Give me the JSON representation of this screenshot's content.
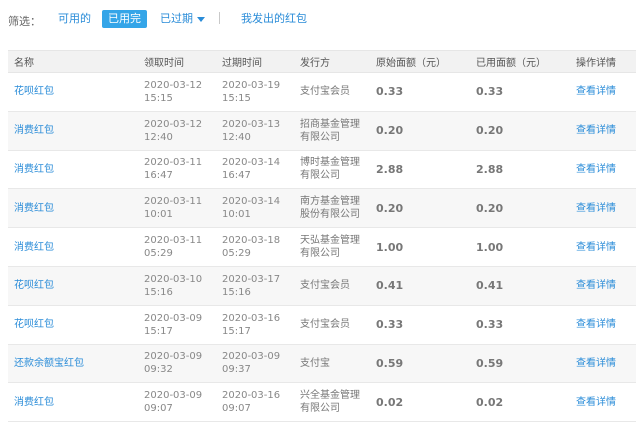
{
  "filter": {
    "label": "筛选：",
    "available": "可用的",
    "used_up": "已用完",
    "expired": "已过期",
    "sent": "我发出的红包"
  },
  "table": {
    "headers": [
      "名称",
      "领取时间",
      "过期时间",
      "发行方",
      "原始面额（元）",
      "已用面额（元）",
      "操作详情"
    ],
    "rows": [
      {
        "name": "花呗红包",
        "recv_date": "2020-03-12",
        "recv_time": "15:15",
        "exp_date": "2020-03-19",
        "exp_time": "15:15",
        "issuer_l1": "支付宝会员",
        "issuer_l2": "",
        "orig": "0.33",
        "used": "0.33",
        "op": "查看详情"
      },
      {
        "name": "消费红包",
        "recv_date": "2020-03-12",
        "recv_time": "12:40",
        "exp_date": "2020-03-13",
        "exp_time": "12:40",
        "issuer_l1": "招商基金管理",
        "issuer_l2": "有限公司",
        "orig": "0.20",
        "used": "0.20",
        "op": "查看详情"
      },
      {
        "name": "消费红包",
        "recv_date": "2020-03-11",
        "recv_time": "16:47",
        "exp_date": "2020-03-14",
        "exp_time": "16:47",
        "issuer_l1": "博时基金管理",
        "issuer_l2": "有限公司",
        "orig": "2.88",
        "used": "2.88",
        "op": "查看详情"
      },
      {
        "name": "消费红包",
        "recv_date": "2020-03-11",
        "recv_time": "10:01",
        "exp_date": "2020-03-14",
        "exp_time": "10:01",
        "issuer_l1": "南方基金管理",
        "issuer_l2": "股份有限公司",
        "orig": "0.20",
        "used": "0.20",
        "op": "查看详情"
      },
      {
        "name": "消费红包",
        "recv_date": "2020-03-11",
        "recv_time": "05:29",
        "exp_date": "2020-03-18",
        "exp_time": "05:29",
        "issuer_l1": "天弘基金管理",
        "issuer_l2": "有限公司",
        "orig": "1.00",
        "used": "1.00",
        "op": "查看详情"
      },
      {
        "name": "花呗红包",
        "recv_date": "2020-03-10",
        "recv_time": "15:16",
        "exp_date": "2020-03-17",
        "exp_time": "15:16",
        "issuer_l1": "支付宝会员",
        "issuer_l2": "",
        "orig": "0.41",
        "used": "0.41",
        "op": "查看详情"
      },
      {
        "name": "花呗红包",
        "recv_date": "2020-03-09",
        "recv_time": "15:17",
        "exp_date": "2020-03-16",
        "exp_time": "15:17",
        "issuer_l1": "支付宝会员",
        "issuer_l2": "",
        "orig": "0.33",
        "used": "0.33",
        "op": "查看详情"
      },
      {
        "name": "还款余额宝红包",
        "recv_date": "2020-03-09",
        "recv_time": "09:32",
        "exp_date": "2020-03-09",
        "exp_time": "09:37",
        "issuer_l1": "支付宝",
        "issuer_l2": "",
        "orig": "0.59",
        "used": "0.59",
        "op": "查看详情"
      },
      {
        "name": "消费红包",
        "recv_date": "2020-03-09",
        "recv_time": "09:07",
        "exp_date": "2020-03-16",
        "exp_time": "09:07",
        "issuer_l1": "兴全基金管理",
        "issuer_l2": "有限公司",
        "orig": "0.02",
        "used": "0.02",
        "op": "查看详情"
      }
    ]
  },
  "colors": {
    "link": "#2a8cd8",
    "active_tab_bg": "#34a5e8",
    "header_bg": "#f2f2f2"
  }
}
